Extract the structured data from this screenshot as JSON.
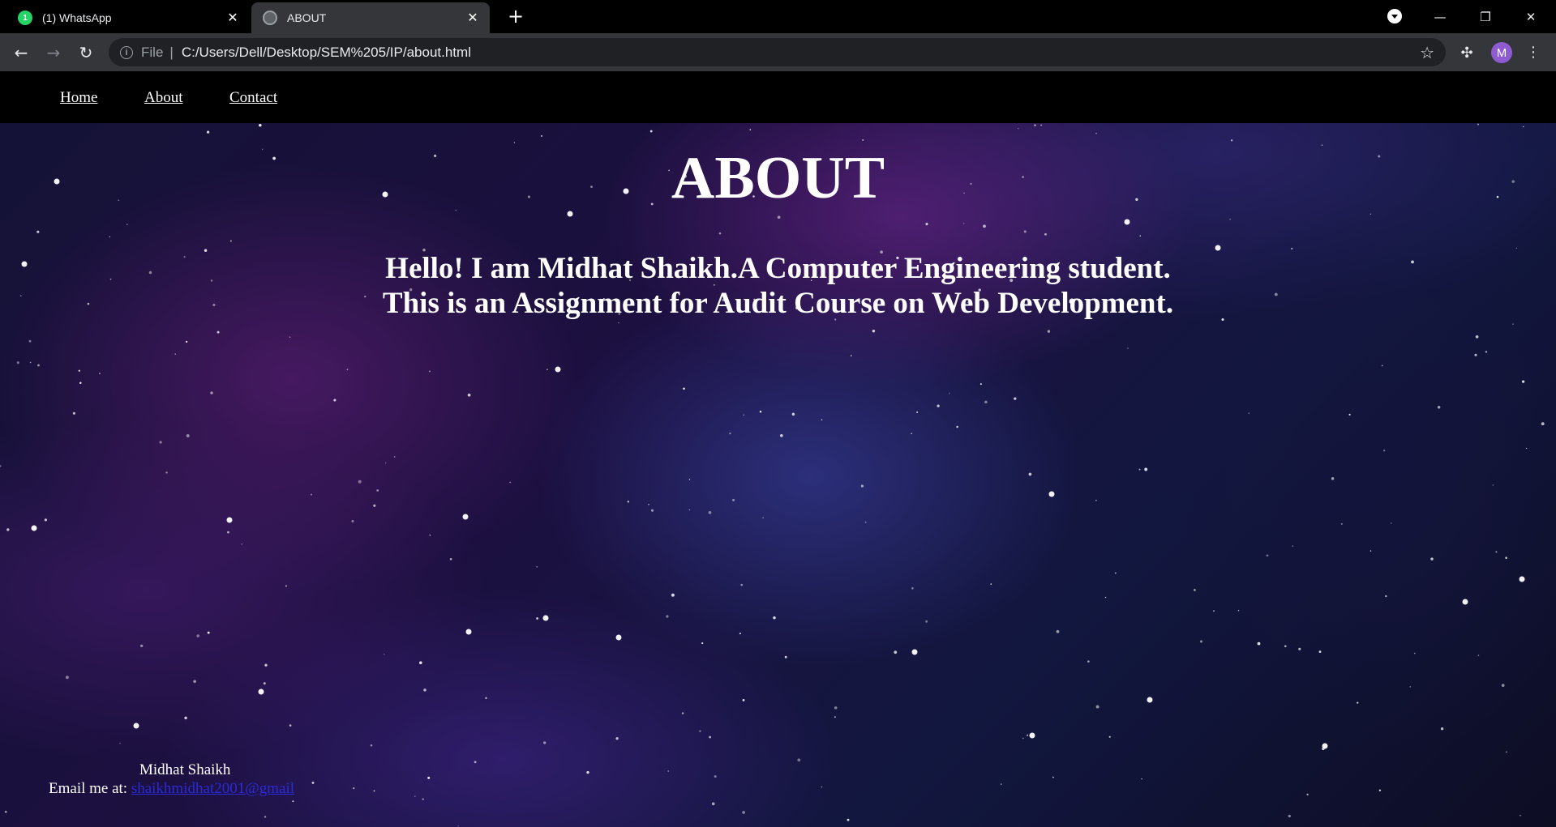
{
  "browser": {
    "tabs": [
      {
        "title": "(1) WhatsApp",
        "badge": "1",
        "icon": "whatsapp-icon",
        "active": false
      },
      {
        "title": "ABOUT",
        "icon": "globe-icon",
        "active": true
      }
    ],
    "new_tab_glyph": "+",
    "address_bar": {
      "scheme_label": "File",
      "url": "C:/Users/Dell/Desktop/SEM%205/IP/about.html"
    },
    "profile_initial": "M"
  },
  "page": {
    "nav": {
      "links": [
        "Home",
        "About",
        "Contact"
      ]
    },
    "title": "ABOUT",
    "intro_line1": "Hello! I am Midhat Shaikh.A Computer Engineering student.",
    "intro_line2": "This is an Assignment for Audit Course on Web Development.",
    "footer": {
      "name": "Midhat Shaikh",
      "email_label": "Email me at:",
      "email_link": "shaikhmidhat2001@gmail"
    }
  }
}
